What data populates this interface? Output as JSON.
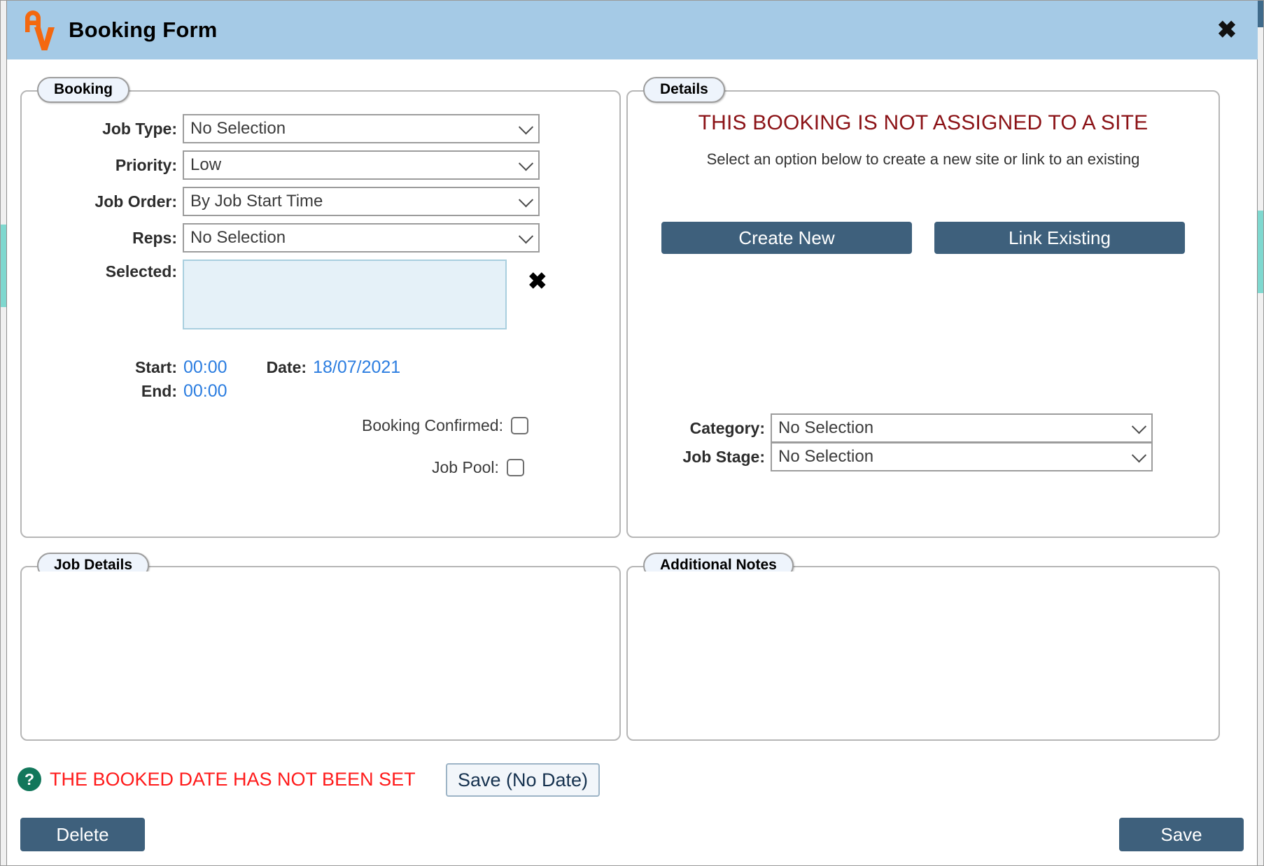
{
  "window": {
    "title": "Booking Form",
    "logo_icon": "av-logo-icon",
    "close_icon": "close-icon",
    "header_color": "#a5cae6",
    "accent_color": "#3e607c",
    "logo_color": "#f4680f"
  },
  "booking": {
    "legend": "Booking",
    "fields": [
      {
        "label": "Job Type:",
        "value": "No Selection"
      },
      {
        "label": "Priority:",
        "value": "Low"
      },
      {
        "label": "Job Order:",
        "value": "By Job Start Time"
      },
      {
        "label": "Reps:",
        "value": "No Selection"
      }
    ],
    "selected": {
      "label": "Selected:",
      "value": "",
      "clear_icon": "clear-x-icon"
    },
    "start": {
      "label": "Start:",
      "value": "00:00"
    },
    "end": {
      "label": "End:",
      "value": "00:00"
    },
    "date": {
      "label": "Date:",
      "value": "18/07/2021"
    },
    "checkboxes": [
      {
        "label": "Booking Confirmed:",
        "checked": false
      },
      {
        "label": "Job Pool:",
        "checked": false
      }
    ]
  },
  "details": {
    "legend": "Details",
    "warning_title": "THIS BOOKING IS NOT ASSIGNED TO A SITE",
    "warning_subtitle": "Select an option below to create a new site or link to an existing",
    "warning_color": "#8b1216",
    "create_new_label": "Create New",
    "link_existing_label": "Link Existing",
    "category": {
      "label": "Category:",
      "value": "No Selection"
    },
    "job_stage": {
      "label": "Job Stage:",
      "value": "No Selection"
    }
  },
  "job_details": {
    "legend": "Job Details",
    "value": ""
  },
  "additional_notes": {
    "legend": "Additional Notes",
    "value": ""
  },
  "footer": {
    "help_icon": "help-question-icon",
    "help_glyph": "?",
    "warning": "THE BOOKED DATE HAS NOT BEEN SET",
    "warning_color": "#ff1a1a",
    "save_no_date_label": "Save (No Date)",
    "delete_label": "Delete",
    "save_label": "Save"
  }
}
